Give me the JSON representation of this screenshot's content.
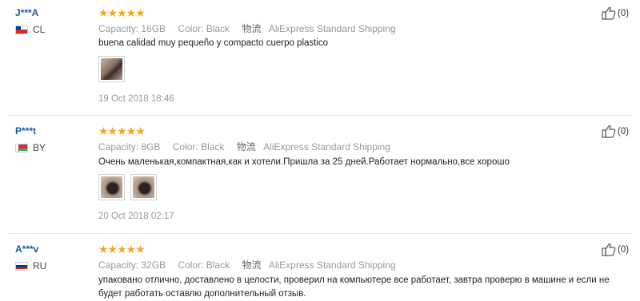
{
  "reviews": [
    {
      "user": "J***A",
      "country": "CL",
      "stars": "★★★★★",
      "capacity_label": "Capacity:",
      "capacity": "16GB",
      "color_label": "Color:",
      "color": "Black",
      "shipping_label": "物流",
      "shipping": "AliExpress Standard Shipping",
      "text": "buena calidad muy pequeño y compacto cuerpo plastico",
      "date": "19 Oct 2018 18:46",
      "likes": "(0)"
    },
    {
      "user": "P***t",
      "country": "BY",
      "stars": "★★★★★",
      "capacity_label": "Capacity:",
      "capacity": "8GB",
      "color_label": "Color:",
      "color": "Black",
      "shipping_label": "物流",
      "shipping": "AliExpress Standard Shipping",
      "text": "Очень маленькая,компактная,как и хотели.Пришла за 25 дней.Работает нормально,все хорошо",
      "date": "20 Oct 2018 02:17",
      "likes": "(0)"
    },
    {
      "user": "A***v",
      "country": "RU",
      "stars": "★★★★★",
      "capacity_label": "Capacity:",
      "capacity": "32GB",
      "color_label": "Color:",
      "color": "Black",
      "shipping_label": "物流",
      "shipping": "AliExpress Standard Shipping",
      "text": "упаковано отлично, доставлено в целости, проверил на компьютере все работает, завтра проверю в машине и если не будет работать оставлю дополнительный отзыв.",
      "likes": "(0)"
    }
  ],
  "colors": {
    "star": "#f5a623",
    "username": "#1a5aa0",
    "muted": "#999999"
  }
}
